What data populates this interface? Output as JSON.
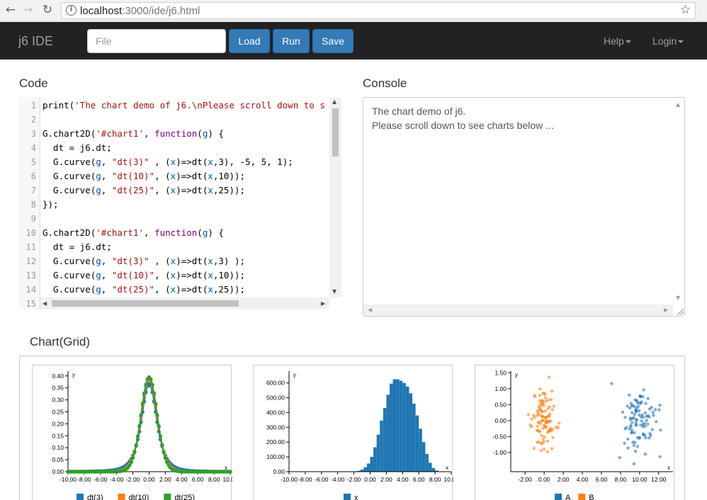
{
  "browser": {
    "url_host": "localhost",
    "url_path": ":3000/ide/j6.html"
  },
  "navbar": {
    "brand": "j6 IDE",
    "file_placeholder": "File",
    "load_label": "Load",
    "run_label": "Run",
    "save_label": "Save",
    "help_label": "Help",
    "login_label": "Login"
  },
  "code_panel": {
    "title": "Code",
    "lines": [
      {
        "n": "1",
        "text": "print('The chart demo of j6.\\nPlease scroll down to s"
      },
      {
        "n": "2",
        "text": ""
      },
      {
        "n": "3",
        "text": "G.chart2D('#chart1', function(g) {"
      },
      {
        "n": "4",
        "text": "  dt = j6.dt;"
      },
      {
        "n": "5",
        "text": "  G.curve(g, \"dt(3)\" , (x)=>dt(x,3), -5, 5, 1);"
      },
      {
        "n": "6",
        "text": "  G.curve(g, \"dt(10)\", (x)=>dt(x,10));"
      },
      {
        "n": "7",
        "text": "  G.curve(g, \"dt(25)\", (x)=>dt(x,25));"
      },
      {
        "n": "8",
        "text": "});"
      },
      {
        "n": "9",
        "text": ""
      },
      {
        "n": "10",
        "text": "G.chart2D('#chart1', function(g) {"
      },
      {
        "n": "11",
        "text": "  dt = j6.dt;"
      },
      {
        "n": "12",
        "text": "  G.curve(g, \"dt(3)\" , (x)=>dt(x,3) );"
      },
      {
        "n": "13",
        "text": "  G.curve(g, \"dt(10)\", (x)=>dt(x,10));"
      },
      {
        "n": "14",
        "text": "  G.curve(g, \"dt(25)\", (x)=>dt(x,25));"
      },
      {
        "n": "15",
        "text": ""
      }
    ]
  },
  "console_panel": {
    "title": "Console",
    "output": "The chart demo of j6.\nPlease scroll down to see charts below ..."
  },
  "chart_section": {
    "title": "Chart(Grid)"
  },
  "colors": {
    "blue": "#1f77b4",
    "orange": "#ff7f0e",
    "green": "#2ca02c",
    "navbar": "#222222",
    "button": "#337ab7"
  },
  "chart_data": [
    {
      "type": "line",
      "title": "",
      "ylabel": "y",
      "xlabel": "x",
      "xlim": [
        -10,
        10
      ],
      "ylim": [
        0,
        0.42
      ],
      "xticks": [
        "-10.00",
        "-8.00",
        "-6.00",
        "-4.00",
        "-2.00",
        "0.00",
        "2.00",
        "4.00",
        "6.00",
        "8.00",
        "10.00"
      ],
      "yticks": [
        "0.00",
        "0.05",
        "0.10",
        "0.15",
        "0.20",
        "0.25",
        "0.30",
        "0.35",
        "0.40"
      ],
      "series": [
        {
          "name": "dt(3)",
          "color": "#1f77b4",
          "df": 3
        },
        {
          "name": "dt(10)",
          "color": "#ff7f0e",
          "df": 10
        },
        {
          "name": "dt(25)",
          "color": "#2ca02c",
          "df": 25
        }
      ],
      "legend": "bottom"
    },
    {
      "type": "bar",
      "title": "",
      "ylabel": "y",
      "xlabel": "x",
      "xlim": [
        -10,
        10
      ],
      "ylim": [
        0,
        680
      ],
      "xticks": [
        "-10.00",
        "-8.00",
        "-6.00",
        "-4.00",
        "-2.00",
        "0.00",
        "2.00",
        "4.00",
        "6.00",
        "8.00",
        "10.00"
      ],
      "yticks": [
        "0.00",
        "100.00",
        "200.00",
        "300.00",
        "400.00",
        "500.00",
        "600.00"
      ],
      "bin_width": 0.4,
      "bins": [
        {
          "x0": -2.0,
          "v": 2
        },
        {
          "x0": -1.6,
          "v": 6
        },
        {
          "x0": -1.2,
          "v": 14
        },
        {
          "x0": -0.8,
          "v": 30
        },
        {
          "x0": -0.4,
          "v": 55
        },
        {
          "x0": 0.0,
          "v": 100
        },
        {
          "x0": 0.4,
          "v": 165
        },
        {
          "x0": 0.8,
          "v": 250
        },
        {
          "x0": 1.2,
          "v": 345
        },
        {
          "x0": 1.6,
          "v": 430
        },
        {
          "x0": 2.0,
          "v": 520
        },
        {
          "x0": 2.4,
          "v": 595
        },
        {
          "x0": 2.8,
          "v": 625
        },
        {
          "x0": 3.2,
          "v": 625
        },
        {
          "x0": 3.6,
          "v": 615
        },
        {
          "x0": 4.0,
          "v": 600
        },
        {
          "x0": 4.4,
          "v": 575
        },
        {
          "x0": 4.8,
          "v": 530
        },
        {
          "x0": 5.2,
          "v": 460
        },
        {
          "x0": 5.6,
          "v": 380
        },
        {
          "x0": 6.0,
          "v": 290
        },
        {
          "x0": 6.4,
          "v": 200
        },
        {
          "x0": 6.8,
          "v": 120
        },
        {
          "x0": 7.2,
          "v": 60
        },
        {
          "x0": 7.6,
          "v": 25
        },
        {
          "x0": 8.0,
          "v": 8
        },
        {
          "x0": 8.4,
          "v": 2
        }
      ],
      "series": [
        {
          "name": "x",
          "color": "#1f77b4"
        }
      ],
      "legend": "bottom"
    },
    {
      "type": "scatter",
      "title": "",
      "ylabel": "y",
      "xlabel": "x",
      "xlim": [
        -3.5,
        13.5
      ],
      "ylim": [
        -1.6,
        1.55
      ],
      "xticks": [
        "-2.00",
        "0.00",
        "2.00",
        "4.00",
        "6.00",
        "8.00",
        "10.00",
        "12.00"
      ],
      "yticks": [
        "1.50",
        "1.00",
        "0.50",
        "0.00",
        "-0.50",
        "-1.00"
      ],
      "series": [
        {
          "name": "A",
          "color": "#1f77b4",
          "center": [
            10,
            0
          ],
          "spread": [
            0.9,
            0.55
          ],
          "n": 100
        },
        {
          "name": "B",
          "color": "#ff7f0e",
          "center": [
            0,
            0
          ],
          "spread": [
            0.7,
            0.5
          ],
          "n": 100
        }
      ],
      "legend": "bottom"
    }
  ]
}
